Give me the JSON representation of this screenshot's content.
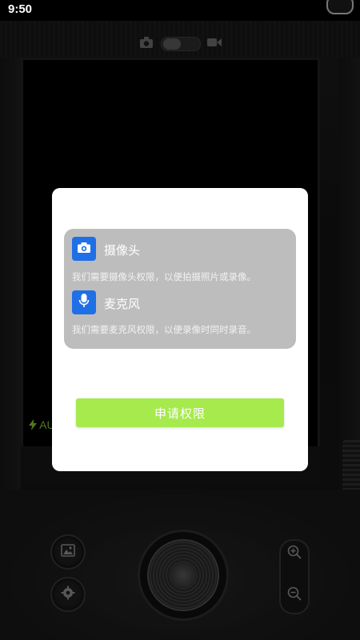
{
  "status_bar": {
    "time": "9:50"
  },
  "camera": {
    "flash_label": "AU",
    "icons": {
      "photo_mode": "camera-icon",
      "video_mode": "video-camera-icon",
      "gallery": "image-icon",
      "settings": "gear-icon",
      "zoom_in": "zoom-in-icon",
      "zoom_out": "zoom-out-icon",
      "flash": "lightning-icon"
    }
  },
  "dialog": {
    "permissions": [
      {
        "icon": "camera-icon",
        "title": "摄像头",
        "description": "我们需要摄像头权限，以便拍摄照片或录像。"
      },
      {
        "icon": "microphone-icon",
        "title": "麦克风",
        "description": "我们需要麦克风权限，以便录像时同时录音。"
      }
    ],
    "request_button_label": "申请权限"
  },
  "colors": {
    "accent_green": "#a6ea4d",
    "permission_icon_blue": "#1f6fe6",
    "card_gray": "#bdbdbd",
    "flash_green": "#7ab82a"
  }
}
